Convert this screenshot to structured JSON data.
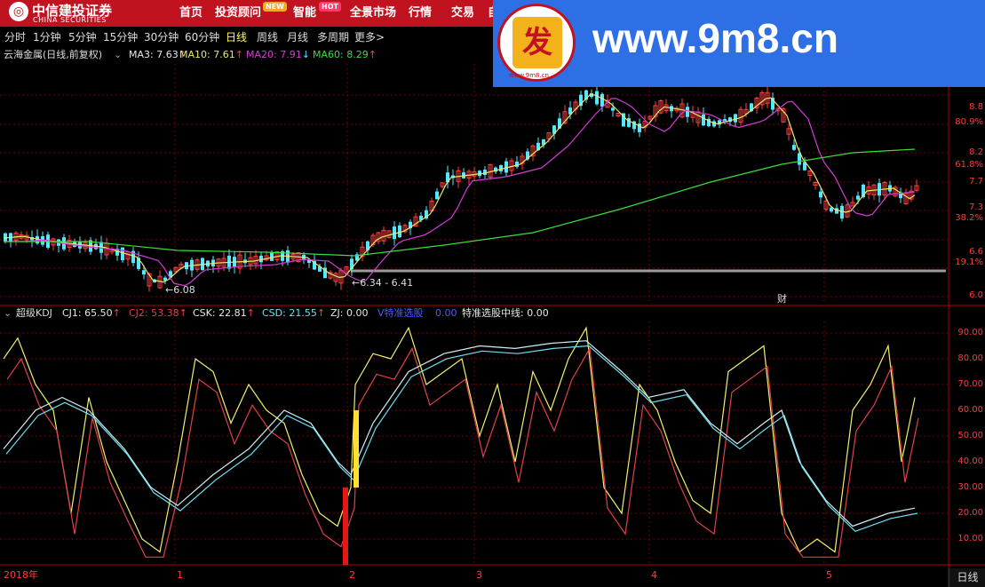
{
  "header": {
    "logo_cn": "中信建投证券",
    "logo_en": "CHINA SECURITIES",
    "nav": [
      {
        "label": "首页"
      },
      {
        "label": "投资顾问",
        "badge": "NEW"
      },
      {
        "label": "智能",
        "badge": "HOT"
      },
      {
        "label": "全景市场"
      },
      {
        "label": "行情"
      },
      {
        "label": "交易"
      },
      {
        "label": "自"
      }
    ]
  },
  "watermark": {
    "url": "www.9m8.cn",
    "seal_char": "发",
    "seal_small": "www.9m8.cn"
  },
  "timeframes": [
    "分时",
    "1分钟",
    "5分钟",
    "15分钟",
    "30分钟",
    "60分钟",
    "日线",
    "周线",
    "月线",
    "多周期",
    "更多>"
  ],
  "active_timeframe": "日线",
  "main_chart": {
    "stock_label": "云海金属(日线,前复权)",
    "ma": [
      {
        "label": "MA3: 7.63",
        "arrow": "↑",
        "color": "#e8e8e8"
      },
      {
        "label": "MA10: 7.61",
        "arrow": "↑",
        "color": "#e8e870"
      },
      {
        "label": "MA20: 7.91",
        "arrow": "↓",
        "color": "#d33dd3"
      },
      {
        "label": "MA60: 8.29",
        "arrow": "↑",
        "color": "#3ddc3d"
      }
    ],
    "annotations": [
      "6.08",
      "6.34 - 6.41",
      "财"
    ],
    "right_labels": [
      "8.8",
      "80.9%",
      "8.2",
      "61.8%",
      "7.7",
      "7.3",
      "38.2%",
      "6.6",
      "19.1%",
      "6.0"
    ]
  },
  "indicator": {
    "name": "超级KDJ",
    "values": [
      {
        "label": "CJ1: 65.50",
        "arrow": "↑",
        "color": "#e8e8e8"
      },
      {
        "label": "CJ2: 53.38",
        "arrow": "↑",
        "color": "#e0404a"
      },
      {
        "label": "CSK: 22.81",
        "arrow": "↑",
        "color": "#e8e8e8"
      },
      {
        "label": "CSD: 21.55",
        "arrow": "↑",
        "color": "#6ee0f0"
      },
      {
        "label": "ZJ: 0.00",
        "arrow": "",
        "color": "#e8e8e8"
      },
      {
        "label": "V特准选股",
        "arrow": "",
        "color": "#4a5cff"
      },
      {
        "label": "0.00",
        "arrow": "",
        "color": "#4a5cff"
      },
      {
        "label": "特准选股中线: 0.00",
        "arrow": "",
        "color": "#e8e8e8"
      }
    ],
    "axis_labels": [
      "90.00",
      "80.00",
      "70.00",
      "60.00",
      "50.00",
      "40.00",
      "30.00",
      "20.00",
      "10.00"
    ]
  },
  "x_axis": {
    "labels": [
      "2018年",
      "1",
      "2",
      "3",
      "4",
      "5"
    ]
  },
  "bottom_tab": "日线",
  "colors": {
    "up": "#ff4040",
    "down": "#54e8ff",
    "grid": "#7a0000",
    "axis_text": "#ff3b3b"
  }
}
